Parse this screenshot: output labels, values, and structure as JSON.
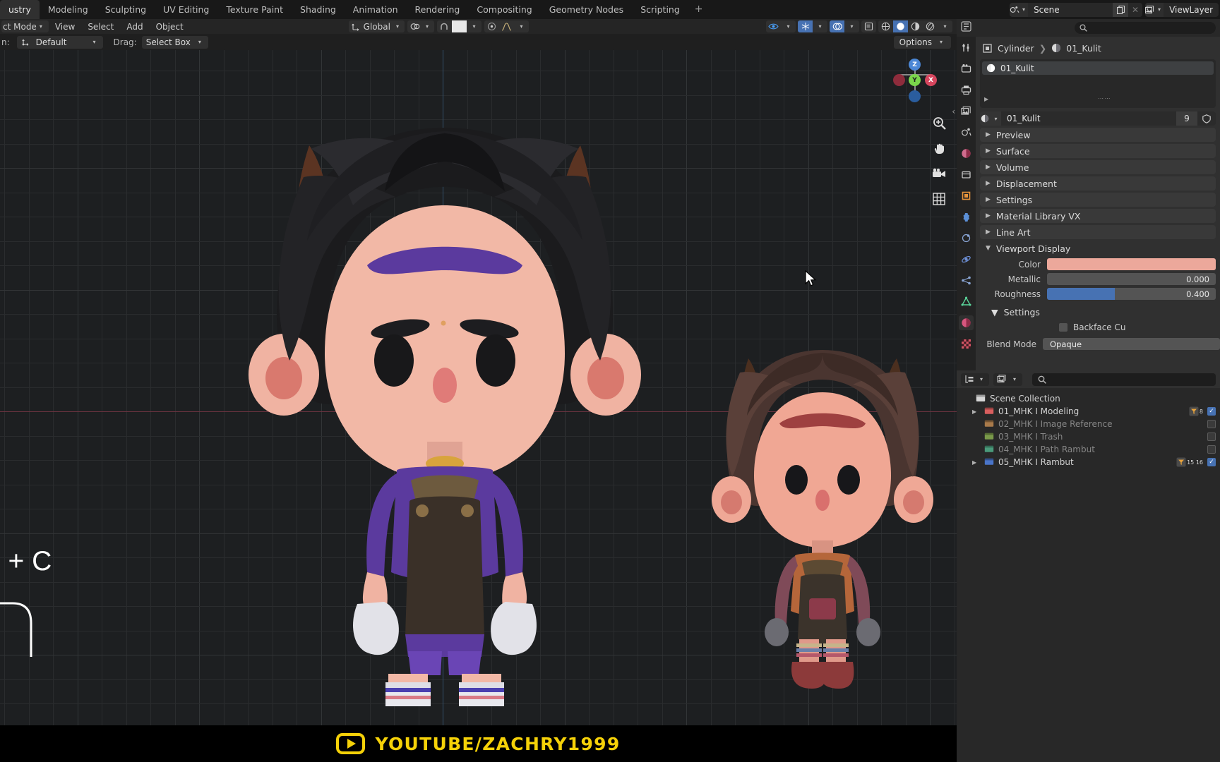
{
  "topbar": {
    "tabs": [
      {
        "label": "ustry",
        "active": true
      },
      {
        "label": "Modeling",
        "active": false
      },
      {
        "label": "Sculpting",
        "active": false
      },
      {
        "label": "UV Editing",
        "active": false
      },
      {
        "label": "Texture Paint",
        "active": false
      },
      {
        "label": "Shading",
        "active": false
      },
      {
        "label": "Animation",
        "active": false
      },
      {
        "label": "Rendering",
        "active": false
      },
      {
        "label": "Compositing",
        "active": false
      },
      {
        "label": "Geometry Nodes",
        "active": false
      },
      {
        "label": "Scripting",
        "active": false
      }
    ],
    "add_tab": "+",
    "scene_name": "Scene",
    "viewlayer_name": "ViewLayer",
    "scene_icon": "scene-icon",
    "new_scene_icon": "copy-icon",
    "remove_scene_icon": "close-icon",
    "viewlayer_icon": "viewlayer-icon"
  },
  "viewport_header": {
    "mode": "ct Mode",
    "menus": [
      "View",
      "Select",
      "Add",
      "Object"
    ],
    "transform_orientation": "Global",
    "snap_icon": "magnet-icon",
    "pivot_icon": "pivot-icon",
    "proportional_icon": "proportional-edit-icon",
    "visibility_icon": "eye-icon",
    "gizmo_icon": "gizmo-icon",
    "overlays_icon": "overlays-icon",
    "xray_icon": "xray-icon",
    "shading_modes": [
      "wireframe",
      "solid",
      "material-preview",
      "rendered"
    ],
    "active_shading": "solid"
  },
  "tool_header": {
    "transform_label": "n:",
    "transform_value": "Default",
    "drag_label": "Drag:",
    "drag_value": "Select Box",
    "options_label": "Options"
  },
  "viewport": {
    "gizmo_axes": [
      "Z",
      "Y",
      "X"
    ],
    "tools": [
      "zoom-icon",
      "pan-icon",
      "camera-icon",
      "grid-icon"
    ],
    "overlay_text": "l + C"
  },
  "watermark": {
    "text": "YOUTUBE/ZACHRY1999",
    "icon": "youtube-play-icon",
    "color": "#f5d108"
  },
  "properties": {
    "editor_icon": "properties-editor-icon",
    "search_placeholder": "",
    "search_icon": "search-icon",
    "breadcrumb": [
      {
        "icon": "object-data-icon",
        "label": "Cylinder"
      },
      {
        "icon": "material-icon",
        "label": "01_Kulit"
      }
    ],
    "material_slots": [
      {
        "label": "01_Kulit",
        "icon": "material-sphere-icon",
        "selected": true
      }
    ],
    "material_name": "01_Kulit",
    "material_users": "9",
    "tabs": [
      "tool-icon",
      "render-icon",
      "output-icon",
      "viewlayer-icon",
      "scene-icon",
      "world-icon",
      "collection-icon",
      "object-icon",
      "modifier-icon",
      "particles-icon",
      "physics-icon",
      "constraints-icon",
      "object-data-icon",
      "material-icon",
      "texture-icon"
    ],
    "active_tab": "material-icon",
    "panels": [
      {
        "label": "Preview",
        "open": false
      },
      {
        "label": "Surface",
        "open": false
      },
      {
        "label": "Volume",
        "open": false
      },
      {
        "label": "Displacement",
        "open": false
      },
      {
        "label": "Settings",
        "open": false
      },
      {
        "label": "Material Library VX",
        "open": false
      },
      {
        "label": "Line Art",
        "open": false
      },
      {
        "label": "Viewport Display",
        "open": true
      }
    ],
    "viewport_display": {
      "color_label": "Color",
      "color_value": "#eca89b",
      "metallic_label": "Metallic",
      "metallic_value": "0.000",
      "metallic_fill": 0,
      "roughness_label": "Roughness",
      "roughness_value": "0.400",
      "roughness_fill": 0.4,
      "slider_color": "#4772b3"
    },
    "settings": {
      "label": "Settings",
      "backface_culling_label": "Backface Cu",
      "backface_culling_checked": false,
      "blend_mode_label": "Blend Mode",
      "blend_mode_value": "Opaque"
    }
  },
  "outliner": {
    "display_mode_icon": "outliner-display-icon",
    "filter_icon": "filter-icon",
    "search_icon": "search-icon",
    "search_placeholder": "",
    "root": {
      "label": "Scene Collection",
      "icon": "scene-collection-icon"
    },
    "items": [
      {
        "label": "01_MHK I Modeling",
        "icon": "collection-icon",
        "color": "#d85e5e",
        "expandable": true,
        "dim": false,
        "badge": "8",
        "badge_icon": "filter-badge-icon",
        "checked": true
      },
      {
        "label": "02_MHK I Image Reference",
        "icon": "collection-icon",
        "color": "#a87a4a",
        "expandable": false,
        "dim": true,
        "badge": "",
        "badge_icon": "",
        "checked": false
      },
      {
        "label": "03_MHK I Trash",
        "icon": "collection-icon",
        "color": "#7a9a4a",
        "expandable": false,
        "dim": true,
        "badge": "",
        "badge_icon": "",
        "checked": false
      },
      {
        "label": "04_MHK I Path Rambut",
        "icon": "collection-icon",
        "color": "#4a9a7a",
        "expandable": false,
        "dim": true,
        "badge": "",
        "badge_icon": "",
        "checked": false
      },
      {
        "label": "05_MHK I Rambut",
        "icon": "collection-icon",
        "color": "#4a74c8",
        "expandable": true,
        "dim": false,
        "badge": "15 16",
        "badge_icon": "mesh-badge-icon",
        "checked": true
      }
    ]
  }
}
